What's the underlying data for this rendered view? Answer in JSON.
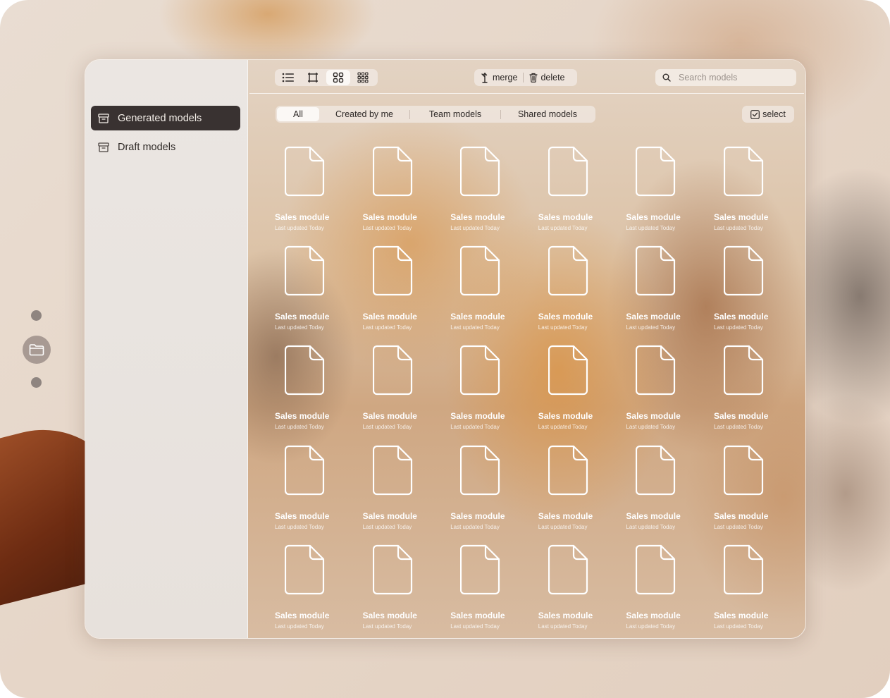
{
  "sidebar": {
    "items": [
      {
        "label": "Generated models",
        "icon": "archive-icon",
        "active": true
      },
      {
        "label": "Draft models",
        "icon": "archive-icon",
        "active": false
      }
    ]
  },
  "toolbar": {
    "views": [
      "list-view-icon",
      "frame-view-icon",
      "grid-view-icon",
      "dense-grid-view-icon"
    ],
    "active_view": "grid-view-icon",
    "merge_label": "merge",
    "delete_label": "delete",
    "search_placeholder": "Search models",
    "search_value": ""
  },
  "filters": {
    "tabs": [
      "All",
      "Created by me",
      "Team models",
      "Shared models"
    ],
    "active": "All",
    "select_label": "select"
  },
  "models": [
    {
      "title": "Sales module",
      "subtitle": "Last updated Today"
    },
    {
      "title": "Sales module",
      "subtitle": "Last updated Today"
    },
    {
      "title": "Sales module",
      "subtitle": "Last updated Today"
    },
    {
      "title": "Sales module",
      "subtitle": "Last updated Today"
    },
    {
      "title": "Sales module",
      "subtitle": "Last updated Today"
    },
    {
      "title": "Sales module",
      "subtitle": "Last updated Today"
    },
    {
      "title": "Sales module",
      "subtitle": "Last updated Today"
    },
    {
      "title": "Sales module",
      "subtitle": "Last updated Today"
    },
    {
      "title": "Sales module",
      "subtitle": "Last updated Today"
    },
    {
      "title": "Sales module",
      "subtitle": "Last updated Today"
    },
    {
      "title": "Sales module",
      "subtitle": "Last updated Today"
    },
    {
      "title": "Sales module",
      "subtitle": "Last updated Today"
    },
    {
      "title": "Sales module",
      "subtitle": "Last updated Today"
    },
    {
      "title": "Sales module",
      "subtitle": "Last updated Today"
    },
    {
      "title": "Sales module",
      "subtitle": "Last updated Today"
    },
    {
      "title": "Sales module",
      "subtitle": "Last updated Today"
    },
    {
      "title": "Sales module",
      "subtitle": "Last updated Today"
    },
    {
      "title": "Sales module",
      "subtitle": "Last updated Today"
    },
    {
      "title": "Sales module",
      "subtitle": "Last updated Today"
    },
    {
      "title": "Sales module",
      "subtitle": "Last updated Today"
    },
    {
      "title": "Sales module",
      "subtitle": "Last updated Today"
    },
    {
      "title": "Sales module",
      "subtitle": "Last updated Today"
    },
    {
      "title": "Sales module",
      "subtitle": "Last updated Today"
    },
    {
      "title": "Sales module",
      "subtitle": "Last updated Today"
    },
    {
      "title": "Sales module",
      "subtitle": "Last updated Today"
    },
    {
      "title": "Sales module",
      "subtitle": "Last updated Today"
    },
    {
      "title": "Sales module",
      "subtitle": "Last updated Today"
    },
    {
      "title": "Sales module",
      "subtitle": "Last updated Today"
    },
    {
      "title": "Sales module",
      "subtitle": "Last updated Today"
    },
    {
      "title": "Sales module",
      "subtitle": "Last updated Today"
    }
  ],
  "side_rail": {
    "icon": "folder-icon"
  },
  "colors": {
    "active_nav_bg": "#393231",
    "active_nav_text": "#f4efe9",
    "card_text": "#ffffff"
  }
}
